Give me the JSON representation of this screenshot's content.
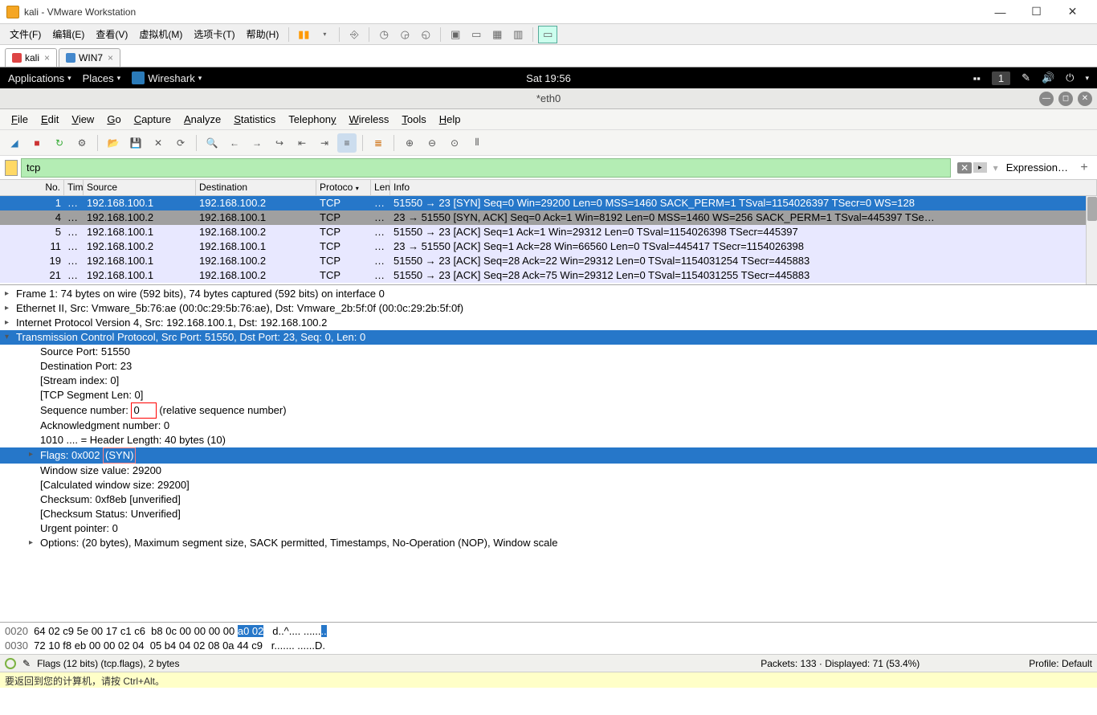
{
  "windows": {
    "title": "kali - VMware Workstation"
  },
  "vmware_menu": [
    "文件(F)",
    "编辑(E)",
    "查看(V)",
    "虚拟机(M)",
    "选项卡(T)",
    "帮助(H)"
  ],
  "vm_tabs": [
    {
      "label": "kali",
      "active": true
    },
    {
      "label": "WIN7",
      "active": false
    }
  ],
  "gnome": {
    "applications": "Applications",
    "places": "Places",
    "app": "Wireshark",
    "time": "Sat 19:56",
    "badge": "1"
  },
  "wireshark": {
    "title": "*eth0",
    "menu": [
      "File",
      "Edit",
      "View",
      "Go",
      "Capture",
      "Analyze",
      "Statistics",
      "Telephony",
      "Wireless",
      "Tools",
      "Help"
    ],
    "filter": "tcp",
    "expression_label": "Expression…",
    "columns": [
      "No.",
      "Tim",
      "Source",
      "Destination",
      "Protoco",
      "Len",
      "Info"
    ],
    "packets": [
      {
        "no": "1",
        "tim": "…",
        "src": "192.168.100.1",
        "dst": "192.168.100.2",
        "proto": "TCP",
        "len": "…",
        "info": "51550 → 23 [SYN] Seq=0 Win=29200 Len=0 MSS=1460 SACK_PERM=1 TSval=1154026397 TSecr=0 WS=128",
        "cls": "pkt-selected"
      },
      {
        "no": "4",
        "tim": "…",
        "src": "192.168.100.2",
        "dst": "192.168.100.1",
        "proto": "TCP",
        "len": "…",
        "info": "23 → 51550 [SYN, ACK] Seq=0 Ack=1 Win=8192 Len=0 MSS=1460 WS=256 SACK_PERM=1 TSval=445397 TSe…",
        "cls": "pkt-gray"
      },
      {
        "no": "5",
        "tim": "…",
        "src": "192.168.100.1",
        "dst": "192.168.100.2",
        "proto": "TCP",
        "len": "…",
        "info": "51550 → 23 [ACK] Seq=1 Ack=1 Win=29312 Len=0 TSval=1154026398 TSecr=445397",
        "cls": "pkt-normal"
      },
      {
        "no": "11",
        "tim": "…",
        "src": "192.168.100.2",
        "dst": "192.168.100.1",
        "proto": "TCP",
        "len": "…",
        "info": "23 → 51550 [ACK] Seq=1 Ack=28 Win=66560 Len=0 TSval=445417 TSecr=1154026398",
        "cls": "pkt-normal"
      },
      {
        "no": "19",
        "tim": "…",
        "src": "192.168.100.1",
        "dst": "192.168.100.2",
        "proto": "TCP",
        "len": "…",
        "info": "51550 → 23 [ACK] Seq=28 Ack=22 Win=29312 Len=0 TSval=1154031254 TSecr=445883",
        "cls": "pkt-normal"
      },
      {
        "no": "21",
        "tim": "…",
        "src": "192.168.100.1",
        "dst": "192.168.100.2",
        "proto": "TCP",
        "len": "…",
        "info": "51550 → 23 [ACK] Seq=28 Ack=75 Win=29312 Len=0 TSval=1154031255 TSecr=445883",
        "cls": "pkt-normal"
      }
    ],
    "details": {
      "frame": "Frame 1: 74 bytes on wire (592 bits), 74 bytes captured (592 bits) on interface 0",
      "eth": "Ethernet II, Src: Vmware_5b:76:ae (00:0c:29:5b:76:ae), Dst: Vmware_2b:5f:0f (00:0c:29:2b:5f:0f)",
      "ip": "Internet Protocol Version 4, Src: 192.168.100.1, Dst: 192.168.100.2",
      "tcp": "Transmission Control Protocol, Src Port: 51550, Dst Port: 23, Seq: 0, Len: 0",
      "srcport": "Source Port: 51550",
      "dstport": "Destination Port: 23",
      "stream": "[Stream index: 0]",
      "seglen": "[TCP Segment Len: 0]",
      "seqnum_pre": "Sequence number: ",
      "seqnum_val": "0",
      "seqnum_post": "    (relative sequence number)",
      "acknum": "Acknowledgment number: 0",
      "hlen": "1010 .... = Header Length: 40 bytes (10)",
      "flags_pre": "Flags: 0x002 ",
      "flags_syn": "(SYN)",
      "winsize": "Window size value: 29200",
      "calcwin": "[Calculated window size: 29200]",
      "checksum": "Checksum: 0xf8eb [unverified]",
      "chkstat": "[Checksum Status: Unverified]",
      "urgent": "Urgent pointer: 0",
      "options": "Options: (20 bytes), Maximum segment size, SACK permitted, Timestamps, No-Operation (NOP), Window scale"
    },
    "hex": {
      "line1_offset": "0020",
      "line1_hex": "  64 02 c9 5e 00 17 c1 c6  b8 0c 00 00 00 00 ",
      "line1_sel": "a0 02",
      "line1_ascii": "   d..^.... ......",
      "line1_ascii_sel": "..",
      "line2_offset": "0030",
      "line2_hex": "  72 10 f8 eb 00 00 02 04  05 b4 04 02 08 0a 44 c9",
      "line2_ascii": "   r....... ......D."
    },
    "status": {
      "left": "Flags (12 bits) (tcp.flags), 2 bytes",
      "mid": "Packets: 133 · Displayed: 71 (53.4%)",
      "right": "Profile: Default"
    }
  },
  "hint": "要返回到您的计算机，请按 Ctrl+Alt。"
}
